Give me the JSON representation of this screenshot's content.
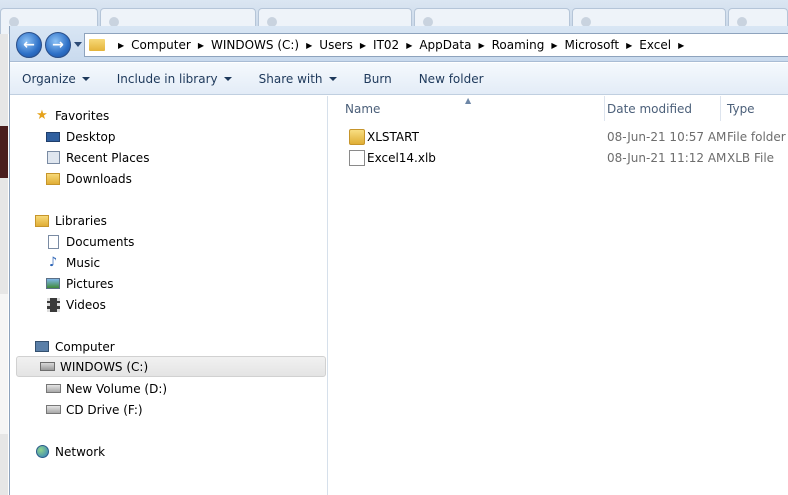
{
  "address": {
    "crumbs": [
      "Computer",
      "WINDOWS (C:)",
      "Users",
      "IT02",
      "AppData",
      "Roaming",
      "Microsoft",
      "Excel"
    ]
  },
  "toolbar": {
    "organize": "Organize",
    "include_in_library": "Include in library",
    "share_with": "Share with",
    "burn": "Burn",
    "new_folder": "New folder"
  },
  "navigation": {
    "favorites": "Favorites",
    "desktop": "Desktop",
    "recent_places": "Recent Places",
    "downloads": "Downloads",
    "libraries": "Libraries",
    "documents": "Documents",
    "music": "Music",
    "pictures": "Pictures",
    "videos": "Videos",
    "computer": "Computer",
    "windows_c": "WINDOWS (C:)",
    "new_volume_d": "New Volume (D:)",
    "cd_drive_f": "CD Drive (F:)",
    "network": "Network"
  },
  "columns": {
    "name": "Name",
    "date_modified": "Date modified",
    "type": "Type"
  },
  "files": [
    {
      "name": "XLSTART",
      "date": "08-Jun-21 10:57 AM",
      "type": "File folder",
      "icon": "folder-icon"
    },
    {
      "name": "Excel14.xlb",
      "date": "08-Jun-21 11:12 AM",
      "type": "XLB File",
      "icon": "file-icon"
    }
  ],
  "colors": {
    "accent": "#2d6fc6",
    "toolbar_text": "#1e395b",
    "folder": "#e4b33a"
  }
}
